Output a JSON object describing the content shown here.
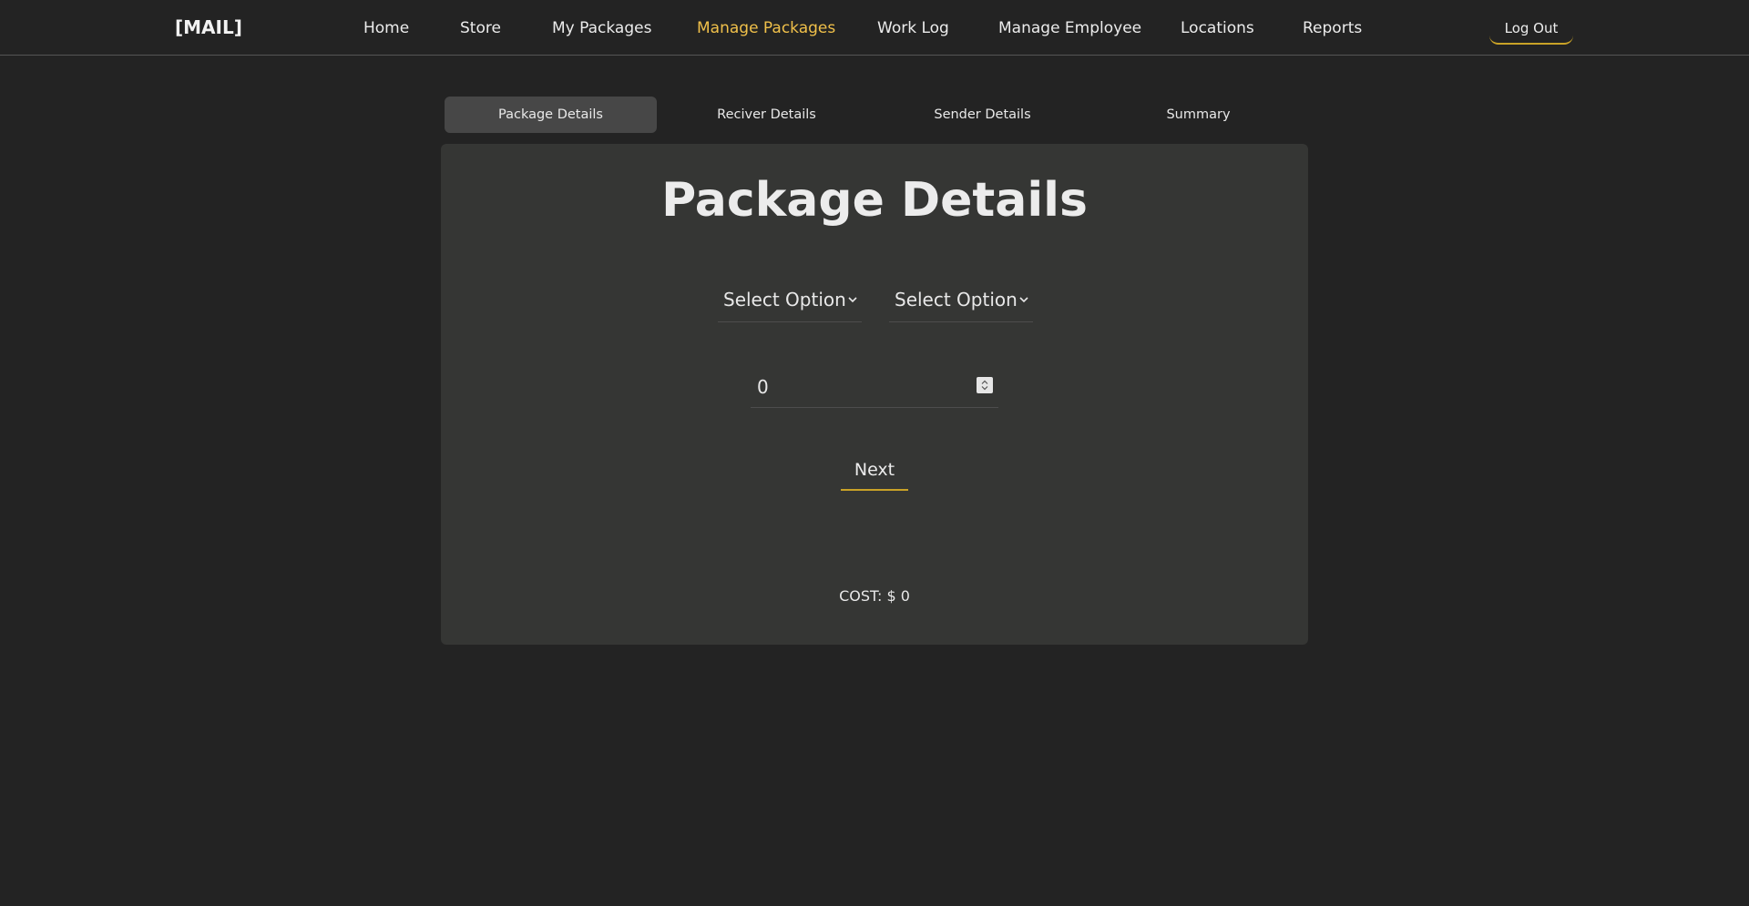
{
  "brand": "[MAIL]",
  "nav": {
    "items": [
      {
        "label": "Home"
      },
      {
        "label": "Store"
      },
      {
        "label": "My Packages"
      },
      {
        "label": "Manage Packages"
      },
      {
        "label": "Work Log"
      },
      {
        "label": "Manage Employee"
      },
      {
        "label": "Locations"
      },
      {
        "label": "Reports"
      }
    ],
    "active": "Manage Packages",
    "logout_label": "Log Out"
  },
  "tabs": [
    {
      "label": "Package Details"
    },
    {
      "label": "Reciver Details"
    },
    {
      "label": "Sender Details"
    },
    {
      "label": "Summary"
    }
  ],
  "active_tab": "Package Details",
  "form": {
    "title": "Package Details",
    "select_1": "Select Option",
    "select_2": "Select Option",
    "quantity": "0",
    "next_label": "Next",
    "cost": "COST: $ 0"
  },
  "colors": {
    "background": "#232323",
    "card": "#353634",
    "accent": "#f0c04a",
    "active_tab": "#474747"
  },
  "icons": [
    "chevron-down-icon",
    "chevron-down-icon",
    "number-spinner-icon"
  ]
}
